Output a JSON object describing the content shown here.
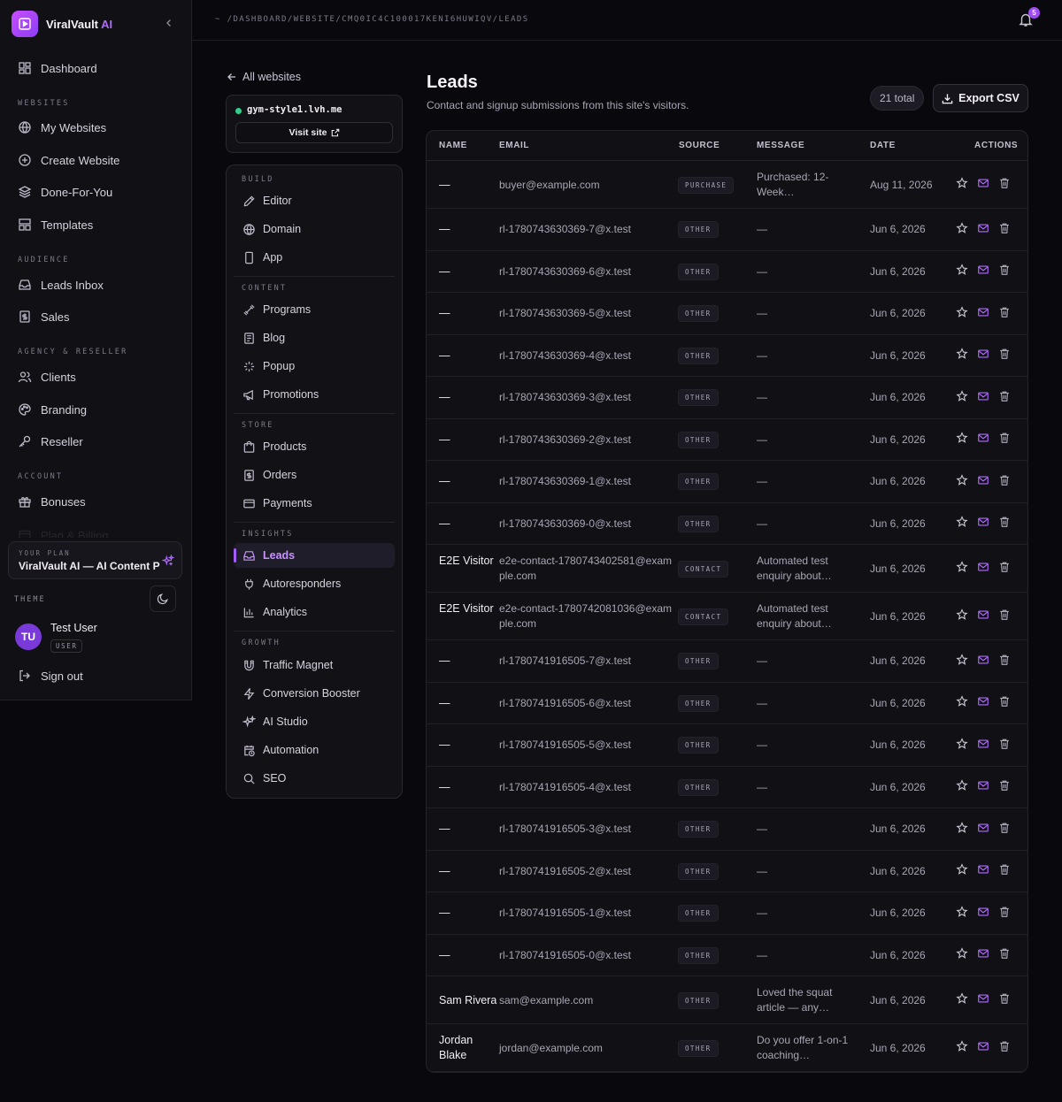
{
  "brand": {
    "name": "ViralVault",
    "name_suffix": "AI",
    "logo_icon": "play-square-icon"
  },
  "sidebar": {
    "top_items": [
      {
        "label": "Dashboard",
        "icon": "grid-icon"
      }
    ],
    "sections": [
      {
        "title": "WEBSITES",
        "items": [
          {
            "label": "My Websites",
            "icon": "globe-icon"
          },
          {
            "label": "Create Website",
            "icon": "plus-circle-icon"
          },
          {
            "label": "Done-For-You",
            "icon": "layers-icon"
          },
          {
            "label": "Templates",
            "icon": "layout-icon"
          }
        ]
      },
      {
        "title": "AUDIENCE",
        "items": [
          {
            "label": "Leads Inbox",
            "icon": "inbox-icon"
          },
          {
            "label": "Sales",
            "icon": "receipt-icon"
          }
        ]
      },
      {
        "title": "AGENCY & RESELLER",
        "items": [
          {
            "label": "Clients",
            "icon": "users-icon"
          },
          {
            "label": "Branding",
            "icon": "palette-icon"
          },
          {
            "label": "Reseller",
            "icon": "key-icon"
          }
        ]
      },
      {
        "title": "ACCOUNT",
        "items": [
          {
            "label": "Bonuses",
            "icon": "gift-icon"
          },
          {
            "label": "Plan & Billing",
            "icon": "card-icon"
          }
        ]
      }
    ],
    "plan": {
      "label": "YOUR PLAN",
      "name": "ViralVault AI — AI Content Pro"
    },
    "theme_label": "THEME",
    "user": {
      "initials": "TU",
      "name": "Test User",
      "role": "USER"
    },
    "signout_label": "Sign out"
  },
  "topbar": {
    "breadcrumb": "~ /DASHBOARD/WEBSITE/CMQ0IC4C100017KENI6HUWIQV/LEADS",
    "notification_count": "5"
  },
  "site_panel": {
    "back_label": "All websites",
    "host": "gym-style1.lvh.me",
    "visit_label": "Visit site",
    "sections": [
      {
        "title": "BUILD",
        "items": [
          {
            "label": "Editor",
            "icon": "pencil-icon"
          },
          {
            "label": "Domain",
            "icon": "globe-icon"
          },
          {
            "label": "App",
            "icon": "phone-icon"
          }
        ]
      },
      {
        "title": "CONTENT",
        "items": [
          {
            "label": "Programs",
            "icon": "dumbbell-icon"
          },
          {
            "label": "Blog",
            "icon": "newspaper-icon"
          },
          {
            "label": "Popup",
            "icon": "sparkle-icon"
          },
          {
            "label": "Promotions",
            "icon": "megaphone-icon"
          }
        ]
      },
      {
        "title": "STORE",
        "items": [
          {
            "label": "Products",
            "icon": "bag-icon"
          },
          {
            "label": "Orders",
            "icon": "receipt-icon"
          },
          {
            "label": "Payments",
            "icon": "card-icon"
          }
        ]
      },
      {
        "title": "INSIGHTS",
        "items": [
          {
            "label": "Leads",
            "icon": "inbox-icon",
            "active": true
          },
          {
            "label": "Autoresponders",
            "icon": "plug-icon"
          },
          {
            "label": "Analytics",
            "icon": "bar-chart-icon"
          }
        ]
      },
      {
        "title": "GROWTH",
        "items": [
          {
            "label": "Traffic Magnet",
            "icon": "magnet-icon"
          },
          {
            "label": "Conversion Booster",
            "icon": "zap-icon"
          },
          {
            "label": "AI Studio",
            "icon": "sparkles-icon"
          },
          {
            "label": "Automation",
            "icon": "calendar-clock-icon"
          },
          {
            "label": "SEO",
            "icon": "search-icon"
          }
        ]
      }
    ]
  },
  "leads": {
    "title": "Leads",
    "subtitle": "Contact and signup submissions from this site's visitors.",
    "total": "21 total",
    "export_label": "Export CSV",
    "columns": [
      "NAME",
      "EMAIL",
      "SOURCE",
      "MESSAGE",
      "DATE",
      "ACTIONS"
    ],
    "rows": [
      {
        "name": "—",
        "email": "buyer@example.com",
        "source": "PURCHASE",
        "message": "Purchased: 12-Week…",
        "date": "Aug 11, 2026"
      },
      {
        "name": "—",
        "email": "rl-1780743630369-7@x.test",
        "source": "OTHER",
        "message": "—",
        "date": "Jun 6, 2026"
      },
      {
        "name": "—",
        "email": "rl-1780743630369-6@x.test",
        "source": "OTHER",
        "message": "—",
        "date": "Jun 6, 2026"
      },
      {
        "name": "—",
        "email": "rl-1780743630369-5@x.test",
        "source": "OTHER",
        "message": "—",
        "date": "Jun 6, 2026"
      },
      {
        "name": "—",
        "email": "rl-1780743630369-4@x.test",
        "source": "OTHER",
        "message": "—",
        "date": "Jun 6, 2026"
      },
      {
        "name": "—",
        "email": "rl-1780743630369-3@x.test",
        "source": "OTHER",
        "message": "—",
        "date": "Jun 6, 2026"
      },
      {
        "name": "—",
        "email": "rl-1780743630369-2@x.test",
        "source": "OTHER",
        "message": "—",
        "date": "Jun 6, 2026"
      },
      {
        "name": "—",
        "email": "rl-1780743630369-1@x.test",
        "source": "OTHER",
        "message": "—",
        "date": "Jun 6, 2026"
      },
      {
        "name": "—",
        "email": "rl-1780743630369-0@x.test",
        "source": "OTHER",
        "message": "—",
        "date": "Jun 6, 2026"
      },
      {
        "name": "E2E Visitor",
        "email": "e2e-contact-1780743402581@example.com",
        "source": "CONTACT",
        "message": "Automated test enquiry about…",
        "date": "Jun 6, 2026"
      },
      {
        "name": "E2E Visitor",
        "email": "e2e-contact-1780742081036@example.com",
        "source": "CONTACT",
        "message": "Automated test enquiry about…",
        "date": "Jun 6, 2026"
      },
      {
        "name": "—",
        "email": "rl-1780741916505-7@x.test",
        "source": "OTHER",
        "message": "—",
        "date": "Jun 6, 2026"
      },
      {
        "name": "—",
        "email": "rl-1780741916505-6@x.test",
        "source": "OTHER",
        "message": "—",
        "date": "Jun 6, 2026"
      },
      {
        "name": "—",
        "email": "rl-1780741916505-5@x.test",
        "source": "OTHER",
        "message": "—",
        "date": "Jun 6, 2026"
      },
      {
        "name": "—",
        "email": "rl-1780741916505-4@x.test",
        "source": "OTHER",
        "message": "—",
        "date": "Jun 6, 2026"
      },
      {
        "name": "—",
        "email": "rl-1780741916505-3@x.test",
        "source": "OTHER",
        "message": "—",
        "date": "Jun 6, 2026"
      },
      {
        "name": "—",
        "email": "rl-1780741916505-2@x.test",
        "source": "OTHER",
        "message": "—",
        "date": "Jun 6, 2026"
      },
      {
        "name": "—",
        "email": "rl-1780741916505-1@x.test",
        "source": "OTHER",
        "message": "—",
        "date": "Jun 6, 2026"
      },
      {
        "name": "—",
        "email": "rl-1780741916505-0@x.test",
        "source": "OTHER",
        "message": "—",
        "date": "Jun 6, 2026"
      },
      {
        "name": "Sam Rivera",
        "email": "sam@example.com",
        "source": "OTHER",
        "message": "Loved the squat article — any…",
        "date": "Jun 6, 2026"
      },
      {
        "name": "Jordan Blake",
        "email": "jordan@example.com",
        "source": "OTHER",
        "message": "Do you offer 1-on-1 coaching…",
        "date": "Jun 6, 2026"
      }
    ],
    "row_actions": [
      "star-icon",
      "mail-icon",
      "trash-icon"
    ]
  },
  "colors": {
    "accent": "#b06cff",
    "online": "#2fcf8c",
    "background": "#09080c"
  }
}
